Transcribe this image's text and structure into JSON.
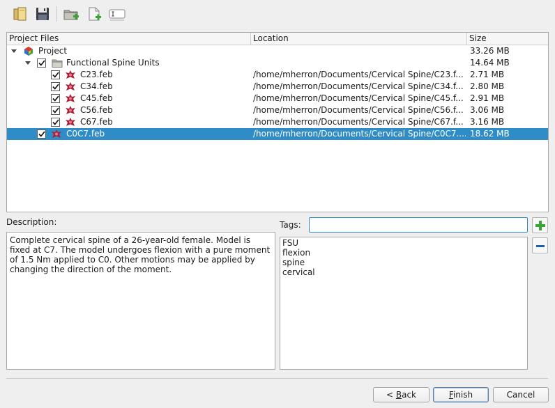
{
  "toolbar": {
    "buttons": [
      {
        "icon": "open-folder-icon"
      },
      {
        "icon": "save-icon"
      },
      {
        "icon": "add-folder-icon"
      },
      {
        "icon": "add-file-icon"
      },
      {
        "icon": "rename-icon"
      }
    ]
  },
  "tree": {
    "columns": [
      "Project Files",
      "Location",
      "Size"
    ],
    "rows": [
      {
        "name": "Project",
        "location": "",
        "size": "33.26 MB",
        "checked": null,
        "expandable": true,
        "icon": "febio-logo-icon"
      },
      {
        "name": "Functional Spine Units",
        "location": "",
        "size": "14.64 MB",
        "checked": true,
        "expandable": true,
        "icon": "folder-icon"
      },
      {
        "name": "C23.feb",
        "location": "/home/mherron/Documents/Cervical Spine/C23.f...",
        "size": "2.71 MB",
        "checked": true,
        "icon": "feb-file-icon"
      },
      {
        "name": "C34.feb",
        "location": "/home/mherron/Documents/Cervical Spine/C34.f...",
        "size": "2.80 MB",
        "checked": true,
        "icon": "feb-file-icon"
      },
      {
        "name": "C45.feb",
        "location": "/home/mherron/Documents/Cervical Spine/C45.f...",
        "size": "2.91 MB",
        "checked": true,
        "icon": "feb-file-icon"
      },
      {
        "name": "C56.feb",
        "location": "/home/mherron/Documents/Cervical Spine/C56.f...",
        "size": "3.06 MB",
        "checked": true,
        "icon": "feb-file-icon"
      },
      {
        "name": "C67.feb",
        "location": "/home/mherron/Documents/Cervical Spine/C67.f...",
        "size": "3.16 MB",
        "checked": true,
        "icon": "feb-file-icon"
      },
      {
        "name": "C0C7.feb",
        "location": "/home/mherron/Documents/Cervical Spine/C0C7....",
        "size": "18.62 MB",
        "checked": true,
        "icon": "feb-file-icon",
        "selected": true
      }
    ]
  },
  "description": {
    "label": "Description:",
    "text": "Complete cervical spine of a 26-year-old female. Model is fixed at C7. The model undergoes flexion with a pure moment of 1.5 Nm applied to C0. Other motions may be applied by changing the direction of the moment."
  },
  "tags": {
    "label": "Tags:",
    "input_value": "",
    "items": [
      "FSU",
      "flexion",
      "spine",
      "cervical"
    ],
    "add_icon": "plus-icon",
    "remove_icon": "minus-icon"
  },
  "footer": {
    "back_prefix": "< ",
    "back_mnemonic": "B",
    "back_rest": "ack",
    "finish_mnemonic": "F",
    "finish_rest": "inish",
    "cancel_label": "Cancel"
  },
  "colors": {
    "selection": "#308cc6",
    "add_green": "#3aa335",
    "remove_blue": "#1f5fb0",
    "feb_red": "#a8203a"
  }
}
